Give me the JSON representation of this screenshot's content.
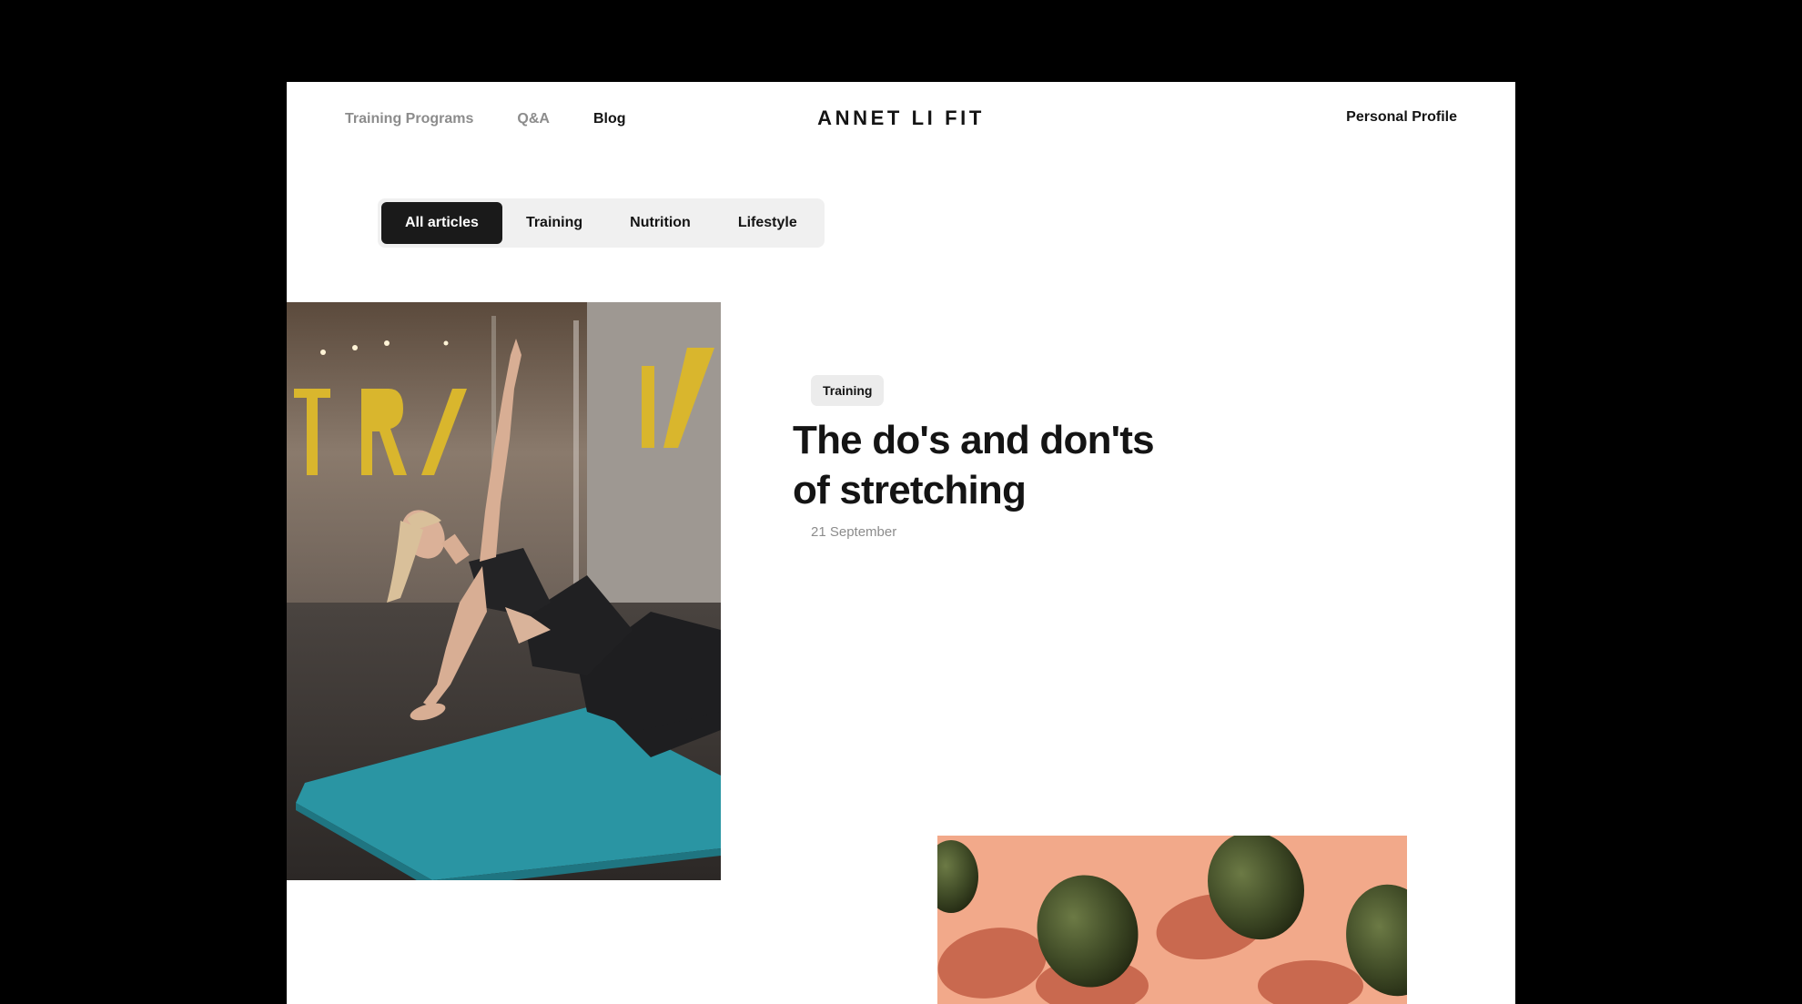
{
  "nav": {
    "links": [
      {
        "label": "Training Programs"
      },
      {
        "label": "Q&A"
      },
      {
        "label": "Blog"
      }
    ],
    "brand": "ANNET LI FIT",
    "profile_label": "Personal Profile"
  },
  "filters": {
    "options": [
      "All articles",
      "Training",
      "Nutrition",
      "Lifestyle"
    ],
    "selected": "All articles"
  },
  "featured_article": {
    "tag": "Training",
    "title": "The do's and don'ts\nof stretching",
    "date": "21 September",
    "image_icon": "woman-side-plank-photo"
  },
  "second_article": {
    "image_icon": "avocados-photo"
  },
  "colors": {
    "background": "#000000",
    "page": "#ffffff",
    "text": "#141414",
    "muted": "#8c8c8c",
    "selected_filter": "#1a1a1a",
    "filter_bar": "#f0f0f0",
    "mat": "#2a95a3",
    "peach": "#f2a98a",
    "gym_yellow": "#d9b62d"
  }
}
